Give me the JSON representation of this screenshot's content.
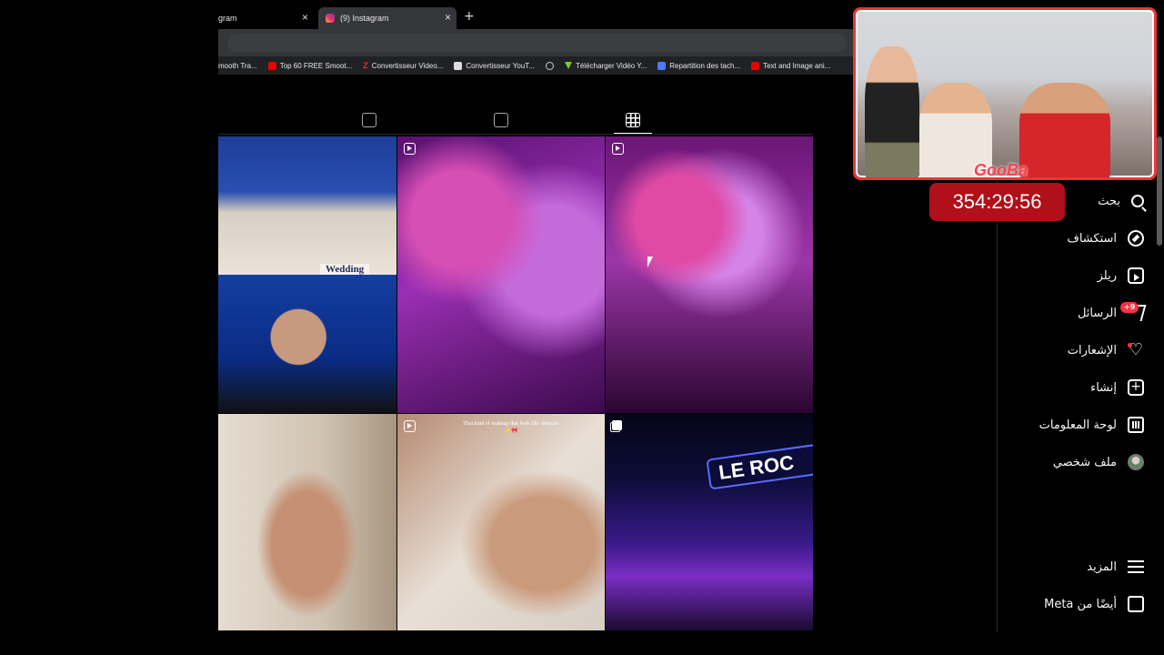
{
  "browser": {
    "tabs": [
      {
        "label": "gram"
      },
      {
        "label": "(9) Instagram"
      }
    ],
    "bookmarks": [
      {
        "label": "mooth Tra...",
        "icon": "none"
      },
      {
        "label": "Top 60 FREE Smoot...",
        "icon": "youtube-icon"
      },
      {
        "label": "Convertisseur Video...",
        "icon": "z-icon"
      },
      {
        "label": "Convertisseur YouT...",
        "icon": "converter-icon"
      },
      {
        "label": "",
        "icon": "globe-icon"
      },
      {
        "label": "Télécharger Vidéo Y...",
        "icon": "download-icon"
      },
      {
        "label": "Repartition des tach...",
        "icon": "doc-icon"
      },
      {
        "label": "Text and Image ani...",
        "icon": "youtube-icon"
      }
    ]
  },
  "grid": {
    "tile1_caption": "Wedding",
    "tile6_caption": "That kind of makeup that feels like skincare ✨🎀",
    "tile7_sign": "LE ROC"
  },
  "sidebar": {
    "items": [
      {
        "label": "بحث"
      },
      {
        "label": "استكشاف"
      },
      {
        "label": "ريلز"
      },
      {
        "label": "الرسائل"
      },
      {
        "label": "الإشعارات"
      },
      {
        "label": "إنشاء"
      },
      {
        "label": "لوحة المعلومات"
      },
      {
        "label": "ملف شخصي"
      }
    ],
    "more": "المزيد",
    "meta": "أيضًا من Meta",
    "messages_badge": "+9"
  },
  "overlay": {
    "webcam_label": "GooBa",
    "timer": "354:29:56"
  }
}
